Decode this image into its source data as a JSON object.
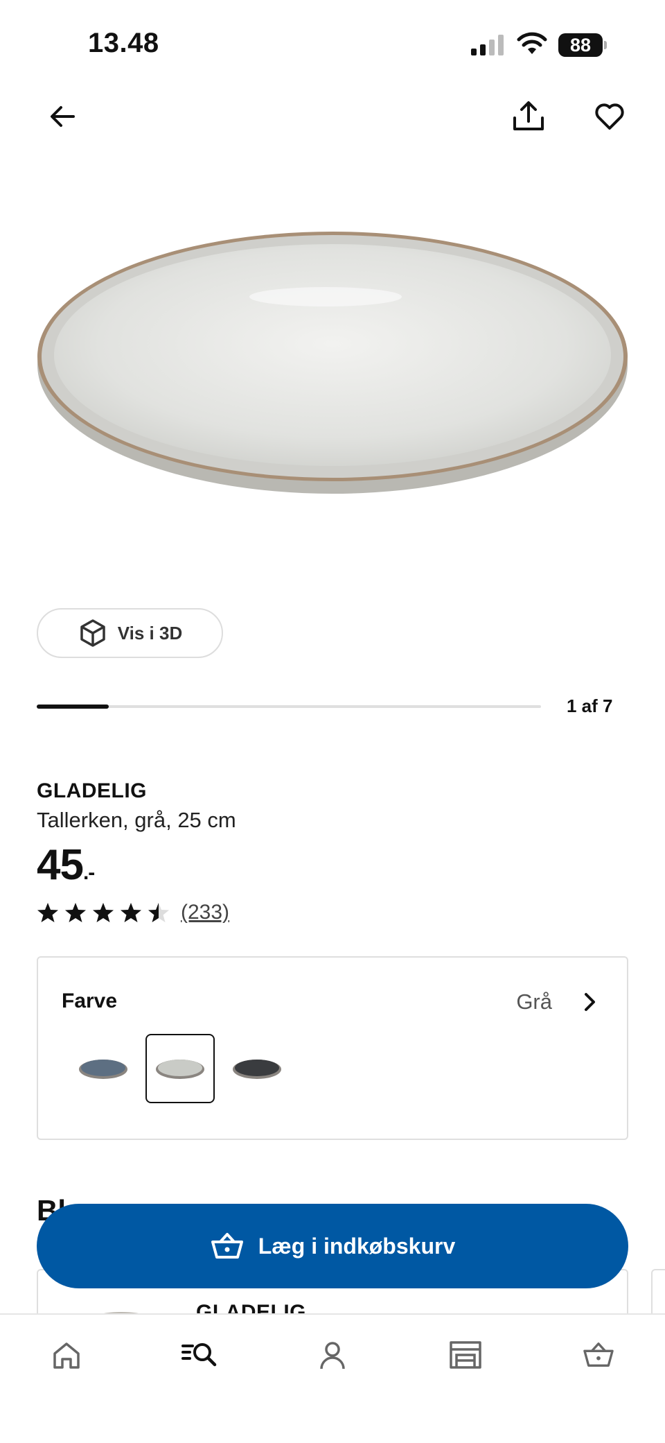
{
  "status_bar": {
    "time": "13.48",
    "battery": "88"
  },
  "product": {
    "name": "GLADELIG",
    "description": "Tallerken, grå, 25 cm",
    "price": "45",
    "price_suffix": ".-",
    "rating": 4.5,
    "review_count": "(233)"
  },
  "gallery": {
    "view_3d_label": "Vis i 3D",
    "counter": "1 af 7",
    "progress": 0.143
  },
  "color_selector": {
    "label": "Farve",
    "selected_value": "Grå",
    "swatches": [
      {
        "color": "#5d6f82",
        "selected": false
      },
      {
        "color": "#c9cbc6",
        "selected": true
      },
      {
        "color": "#3a3c3f",
        "selected": false
      }
    ]
  },
  "section_peek": "Bl",
  "recommendation": {
    "name": "GLADELIG"
  },
  "cart_button": {
    "label": "Læg i indkøbskurv"
  },
  "bottom_nav": [
    "home-icon",
    "search-icon",
    "profile-icon",
    "store-icon",
    "cart-icon"
  ],
  "colors": {
    "brand_blue": "#0058a3"
  }
}
